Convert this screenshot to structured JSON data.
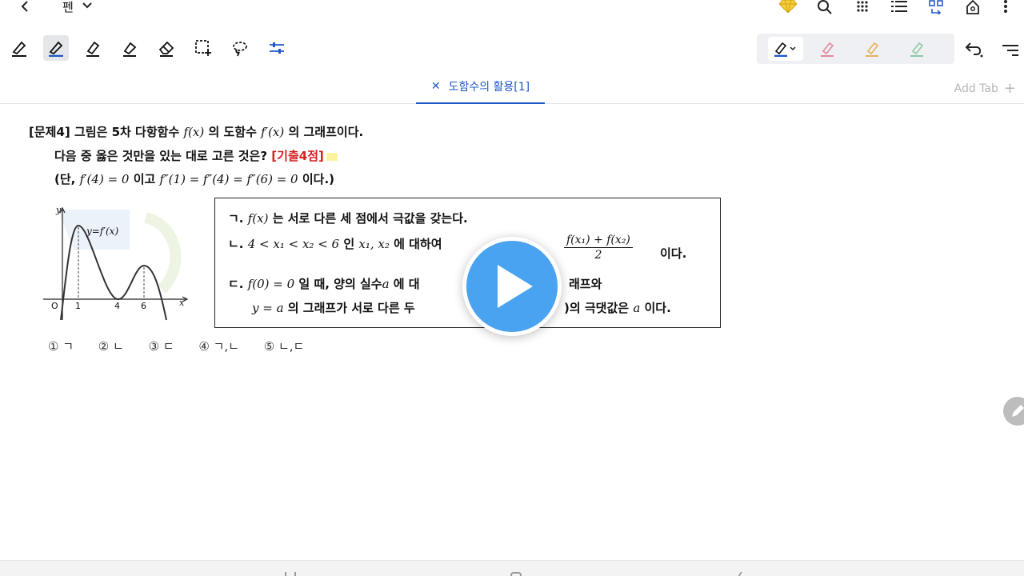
{
  "app": {
    "mode_label": "펜",
    "tab_title": "도함수의 활용[1]",
    "add_tab_label": "Add Tab"
  },
  "topbar_icons": [
    "back-icon",
    "chevron-down-icon",
    "premium-diamond-icon",
    "search-icon",
    "grid-icon",
    "list-icon",
    "layout-icon",
    "home-icon",
    "more-icon"
  ],
  "toolbar_icons": [
    "pen-icon",
    "pen-active-icon",
    "highlighter-icon",
    "brush-icon",
    "eraser-icon",
    "select-rect-icon",
    "lasso-icon",
    "settings-sliders-icon"
  ],
  "colors": {
    "accent": "#1e58c8",
    "red_text": "#d32020",
    "play_blue": "#4aa3f0",
    "pen_pink": "#e08a9a",
    "pen_orange": "#e6b25a",
    "pen_green": "#8cc9a6"
  },
  "problem": {
    "line1_a": "[문제4] 그림은 5차 다항함수",
    "line1_f": "f(x)",
    "line1_b": "의 도함수",
    "line1_fp": "f′(x)",
    "line1_c": "의 그래프이다.",
    "line2_a": "다음 중 옳은 것만을 있는 대로 고른 것은?",
    "line2_tag": "[기출4점]",
    "line3_a": "(단,",
    "line3_m1": "f′(4) = 0",
    "line3_b": "이고",
    "line3_m2": "f″(1) = f″(4) = f″(6) = 0",
    "line3_c": "이다.)"
  },
  "graph": {
    "curve_label": "y=f′(x)",
    "y_axis": "y",
    "x_axis": "x",
    "origin": "O",
    "ticks": [
      "1",
      "4",
      "6"
    ]
  },
  "statements": {
    "s1_a": "ㄱ.",
    "s1_m": "f(x)",
    "s1_b": "는 서로 다른 세 점에서 극값을 갖는다.",
    "s2_a": "ㄴ.",
    "s2_m1": "4 < x₁ < x₂ < 6",
    "s2_b": "인",
    "s2_m2": "x₁, x₂",
    "s2_c": "에 대하여",
    "s2_num": "f(x₁) + f(x₂)",
    "s2_den": "2",
    "s2_d": "이다.",
    "s3_a": "ㄷ.",
    "s3_m1": "f(0) = 0",
    "s3_b": "일 때, 양의 실수",
    "s3_m2": "a",
    "s3_c": "에 대",
    "s3_d": "래프와",
    "s3_e": "y = a",
    "s3_f": "의 그래프가 서로 다른 두 ",
    "s3_g": ")의 극댓값은",
    "s3_h": "a",
    "s3_i": "이다."
  },
  "choices": [
    "① ㄱ",
    "② ㄴ",
    "③ ㄷ",
    "④ ㄱ,ㄴ",
    "⑤ ㄴ,ㄷ"
  ]
}
